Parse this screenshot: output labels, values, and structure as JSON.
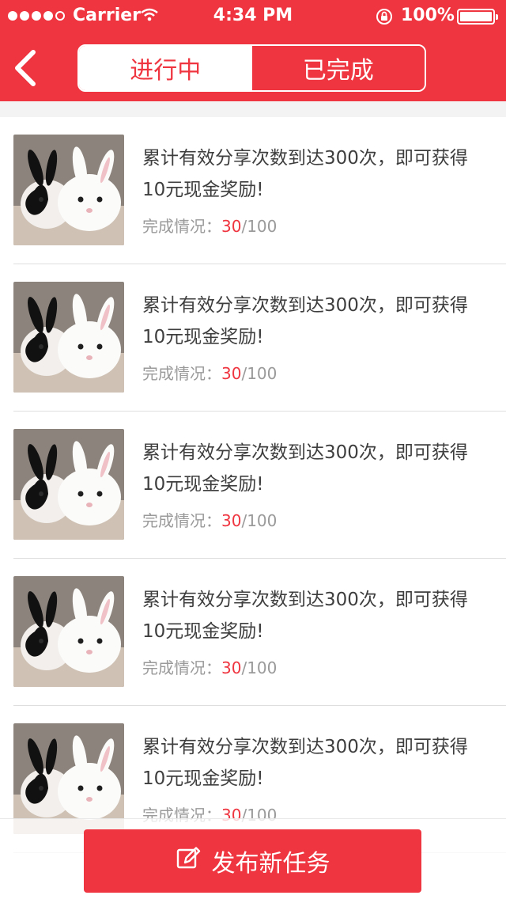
{
  "status_bar": {
    "carrier": "Carrier",
    "time": "4:34 PM",
    "battery": "100%"
  },
  "nav": {
    "tabs": [
      {
        "label": "进行中",
        "active": true
      },
      {
        "label": "已完成",
        "active": false
      }
    ]
  },
  "tasks": [
    {
      "title": "累计有效分享次数到达300次，即可获得10元现金奖励!",
      "progress_label": "完成情况：",
      "progress_done": "30",
      "progress_total": "/100"
    },
    {
      "title": "累计有效分享次数到达300次，即可获得10元现金奖励!",
      "progress_label": "完成情况：",
      "progress_done": "30",
      "progress_total": "/100"
    },
    {
      "title": "累计有效分享次数到达300次，即可获得10元现金奖励!",
      "progress_label": "完成情况：",
      "progress_done": "30",
      "progress_total": "/100"
    },
    {
      "title": "累计有效分享次数到达300次，即可获得10元现金奖励!",
      "progress_label": "完成情况：",
      "progress_done": "30",
      "progress_total": "/100"
    },
    {
      "title": "累计有效分享次数到达300次，即可获得10元现金奖励!",
      "progress_label": "完成情况：",
      "progress_done": "30",
      "progress_total": "/100"
    }
  ],
  "publish_button": {
    "label": "发布新任务",
    "icon": "edit-icon"
  },
  "colors": {
    "accent": "#ef3540"
  }
}
